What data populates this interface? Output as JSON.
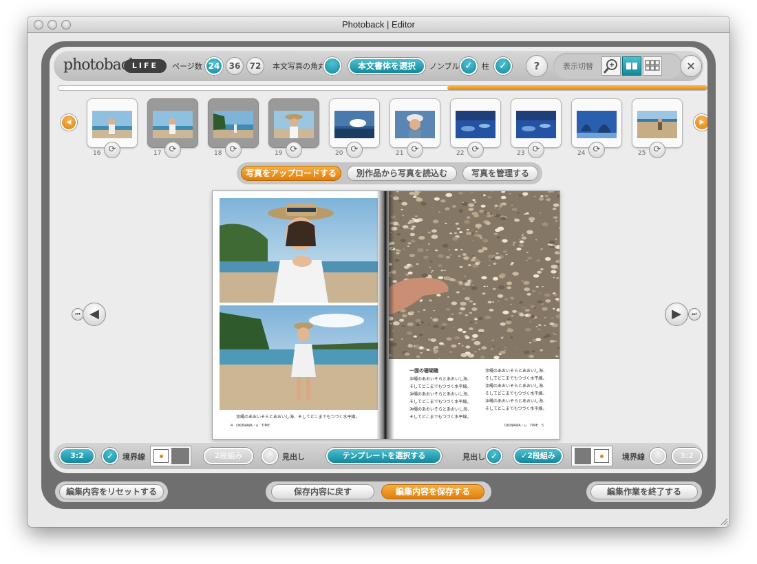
{
  "window": {
    "title": "Photoback | Editor"
  },
  "toolbar": {
    "logo": "photoback",
    "logo_mark": "®",
    "edition": "LIFE",
    "page_count_label": "ページ数",
    "page_options": [
      "24",
      "36",
      "72"
    ],
    "selected_pages": "24",
    "rounded_corners_label": "本文写真の角丸",
    "font_select_button": "本文書体を選択",
    "nombre_label": "ノンブル",
    "hashira_label": "柱",
    "help": "?",
    "view_switch_label": "表示切替",
    "close": "×"
  },
  "progress": {
    "value": 0.4
  },
  "thumbnails": [
    {
      "num": "16",
      "used": false,
      "scene": "girl-beach"
    },
    {
      "num": "17",
      "used": true,
      "scene": "girl-beach"
    },
    {
      "num": "18",
      "used": true,
      "scene": "beach-sea"
    },
    {
      "num": "19",
      "used": true,
      "scene": "girl-portrait"
    },
    {
      "num": "20",
      "used": false,
      "scene": "sky-sea"
    },
    {
      "num": "21",
      "used": false,
      "scene": "boy-portrait"
    },
    {
      "num": "22",
      "used": false,
      "scene": "pool-blue"
    },
    {
      "num": "23",
      "used": false,
      "scene": "pool-blue"
    },
    {
      "num": "24",
      "used": false,
      "scene": "pool-palm"
    },
    {
      "num": "25",
      "used": false,
      "scene": "beach-sand"
    }
  ],
  "photo_actions": {
    "upload": "写真をアップロードする",
    "import": "別作品から写真を読込む",
    "manage": "写真を管理する"
  },
  "spread": {
    "left_caption": "沖縄のあおいそらとあおいし海、そしてどこまでもつづく水平線。",
    "left_folio": "4　OKINAWA・u　TIME",
    "right_heading": "一面の珊瑚礁",
    "right_col1": "沖縄のあおいそらとあおいし海、そしてどこまでもつづく水平線。沖縄のあおいそらとあおいし海、そしてどこまでもつづく水平線。沖縄のあおいそらとあおいし海、そしてどこまでもつづく水平線。",
    "right_col2": "沖縄のあおいそらとあおいし海、そしてどこまでもつづく水平線。沖縄のあおいそらとあおいし海、そしてどこまでもつづく水平線。沖縄のあおいそらとあおいし海、そしてどこまでもつづく水平線。",
    "right_folio": "OKINAWA・u　TIME　5"
  },
  "bottom_tools": {
    "left_ratio": "3:2",
    "left_border_label": "境界線",
    "left_two_column": "2段組み",
    "left_heading_label": "見出し",
    "template_button": "テンプレートを選択する",
    "right_heading_label": "見出し",
    "right_two_column": "2段組み",
    "right_border_label": "境界線",
    "right_ratio": "3:2"
  },
  "footer": {
    "reset": "編集内容をリセットする",
    "revert": "保存内容に戻す",
    "save": "編集内容を保存する",
    "finish": "編集作業を終了する"
  },
  "colors": {
    "teal": "#148a9e",
    "orange": "#e08512",
    "frame": "#6f6f6f"
  }
}
